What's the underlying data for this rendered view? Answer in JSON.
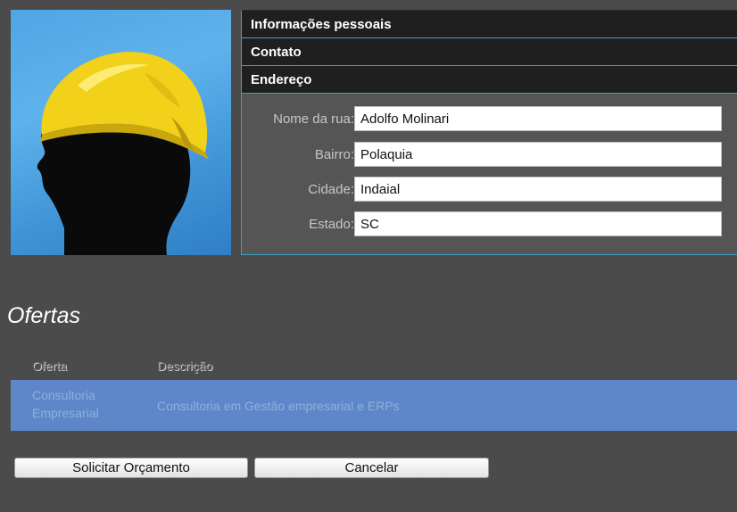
{
  "accordion": {
    "sections": [
      {
        "label": "Informações pessoais"
      },
      {
        "label": "Contato"
      },
      {
        "label": "Endereço"
      }
    ],
    "address": {
      "street_label": "Nome da rua:",
      "street_value": "Adolfo Molinari",
      "district_label": "Bairro:",
      "district_value": "Polaquia",
      "city_label": "Cidade:",
      "city_value": "Indaial",
      "state_label": "Estado:",
      "state_value": "SC"
    }
  },
  "offers": {
    "title": "Ofertas",
    "columns": [
      "Oferta",
      "Descrição"
    ],
    "rows": [
      {
        "offer_line1": "Consultoria",
        "offer_line2": "Empresarial",
        "description": "Consultoria em Gestão empresarial e ERPs"
      }
    ]
  },
  "actions": {
    "request_quote": "Solicitar Orçamento",
    "cancel": "Cancelar"
  },
  "colors": {
    "background": "#4b4b4b",
    "header": "#1f1f1f",
    "accent_border": "#3aa3c0",
    "selected_row": "#5d87c8"
  }
}
